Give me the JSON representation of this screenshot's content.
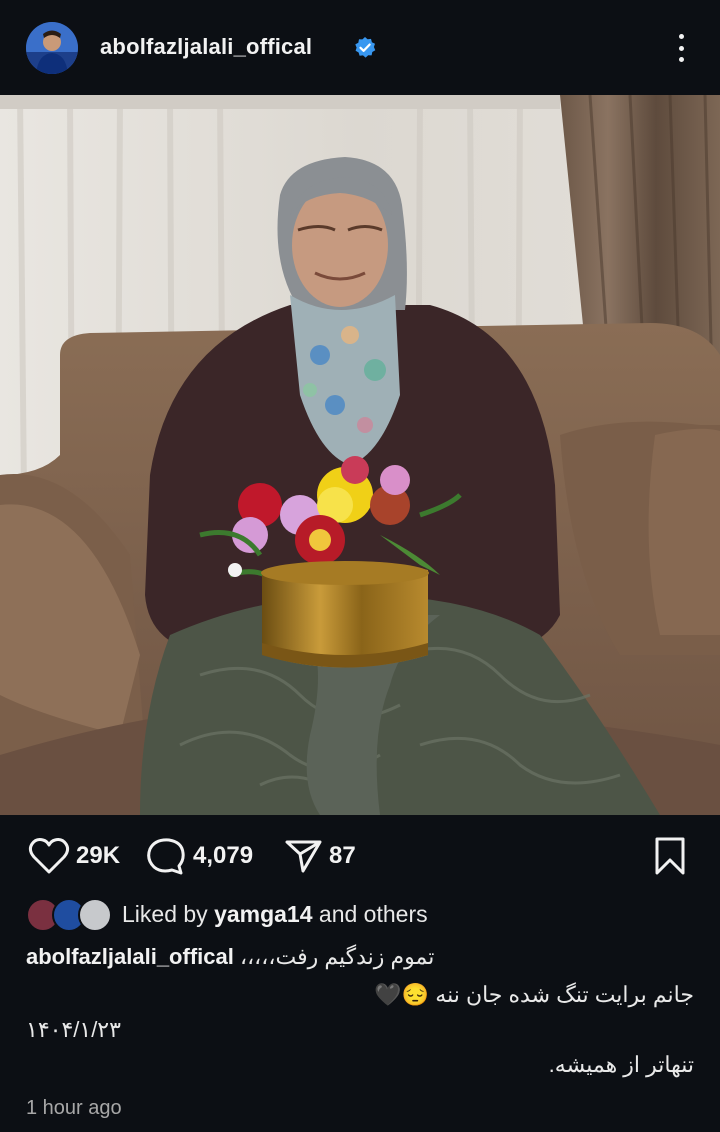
{
  "post": {
    "username": "abolfazljalali_offical",
    "verified": true,
    "more_icon": "more-vertical-icon"
  },
  "actions": {
    "likes": "29K",
    "comments": "4,079",
    "shares": "87"
  },
  "liked_by": {
    "prefix": "Liked by",
    "user": "yamga14",
    "suffix": "and others"
  },
  "caption": {
    "username": "abolfazljalali_offical",
    "line1": "تموم زندگیم رفت،،،،،",
    "line2": "جانم برایت تنگ شده جان ننه",
    "line2_emoji": "🖤😔",
    "date": "۱۴۰۴/۱/۲۳",
    "line3": "تنهاتر از همیشه."
  },
  "time": "1 hour ago",
  "colors": {
    "background": "#0c0f14",
    "verified": "#3897f0",
    "text": "#f2f2f2",
    "muted": "#a7a7a7"
  }
}
